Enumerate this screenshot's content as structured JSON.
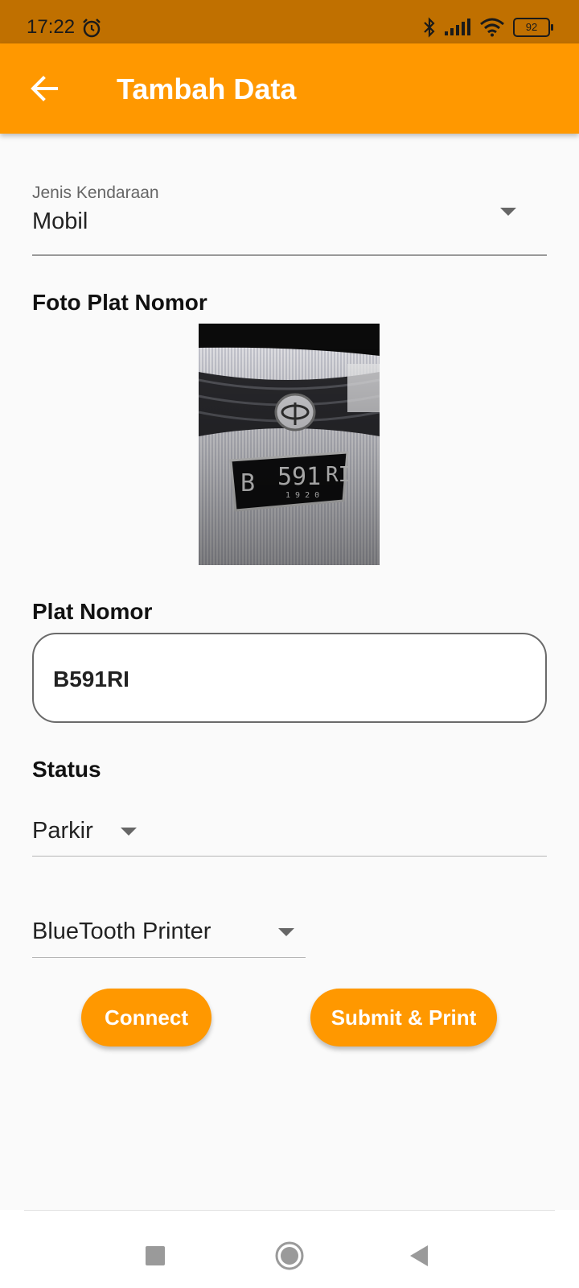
{
  "status_bar": {
    "time": "17:22",
    "battery": "92",
    "icons": [
      "alarm-icon",
      "bluetooth-icon",
      "signal-icon",
      "wifi-icon",
      "battery-icon"
    ]
  },
  "app_bar": {
    "title": "Tambah Data",
    "background": "#ff9800"
  },
  "vehicle_type": {
    "label": "Jenis Kendaraan",
    "value": "Mobil"
  },
  "photo_section": {
    "label": "Foto Plat Nomor"
  },
  "plate_number": {
    "label": "Plat Nomor",
    "value": "B591RI"
  },
  "status": {
    "label": "Status",
    "value": "Parkir"
  },
  "printer": {
    "value": "BlueTooth Printer"
  },
  "buttons": {
    "connect": "Connect",
    "submit": "Submit & Print"
  },
  "nav": {
    "icons": [
      "recents-icon",
      "home-icon",
      "back-icon"
    ]
  }
}
